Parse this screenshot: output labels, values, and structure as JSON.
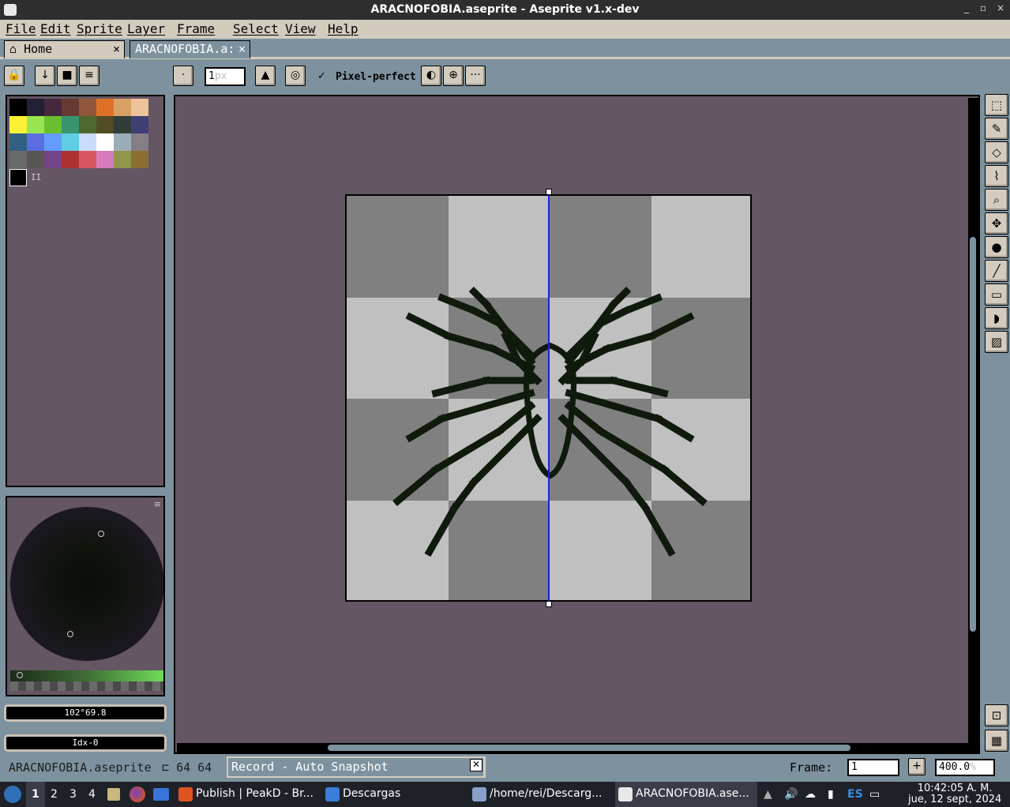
{
  "window": {
    "title": "ARACNOFOBIA.aseprite - Aseprite v1.x-dev",
    "controls": [
      "_",
      "▫",
      "×"
    ]
  },
  "menu": [
    "File",
    "Edit",
    "Sprite",
    "Layer",
    "Frame",
    "Select",
    "View",
    "Help"
  ],
  "tabs": [
    {
      "label": "Home",
      "close": "×",
      "active": false
    },
    {
      "label": "ARACNOFOBIA.a:",
      "close": "×",
      "active": true
    }
  ],
  "toolbar": {
    "brush_size_value": "1",
    "brush_size_unit": "px",
    "pixel_perfect_checked": true,
    "pixel_perfect_check": "✓",
    "pixel_perfect_label": "Pixel-perfect",
    "more_label": "···"
  },
  "palette": {
    "colors": [
      "#000000",
      "#222034",
      "#45283c",
      "#663931",
      "#8f563b",
      "#df7126",
      "#d9a066",
      "#eec39a",
      "#fbf236",
      "#99e550",
      "#6abe30",
      "#37946e",
      "#4b692f",
      "#524b24",
      "#323c39",
      "#3f3f74",
      "#306082",
      "#5b6ee1",
      "#639bff",
      "#5fcde4",
      "#cbdbfc",
      "#ffffff",
      "#9badb7",
      "#847e87",
      "#696a6a",
      "#595652",
      "#76428a",
      "#ac3232",
      "#d95763",
      "#d77bba",
      "#8f974a",
      "#8a6f30"
    ],
    "extra_label": "II"
  },
  "color_selector": {
    "hsv_readout": "102°69.8",
    "index_readout": "Idx-0"
  },
  "sprite": {
    "width": 64,
    "height": 64,
    "checker": [
      "dark",
      "light",
      "dark",
      "light",
      "light",
      "dark",
      "light",
      "dark",
      "dark",
      "light",
      "dark",
      "light",
      "light",
      "dark",
      "light",
      "dark"
    ],
    "primary_color": "#0f1a0c"
  },
  "tools": [
    {
      "name": "rectangular-marquee-icon",
      "glyph": "⬚"
    },
    {
      "name": "pencil-icon",
      "glyph": "✎"
    },
    {
      "name": "eraser-icon",
      "glyph": "◇"
    },
    {
      "name": "eyedropper-icon",
      "glyph": "⌇"
    },
    {
      "name": "zoom-icon",
      "glyph": "⌕"
    },
    {
      "name": "move-icon",
      "glyph": "✥"
    },
    {
      "name": "paint-bucket-icon",
      "glyph": "●"
    },
    {
      "name": "line-icon",
      "glyph": "╱"
    },
    {
      "name": "rectangle-icon",
      "glyph": "▭"
    },
    {
      "name": "contour-icon",
      "glyph": "◗"
    },
    {
      "name": "blur-icon",
      "glyph": "▨"
    }
  ],
  "status": {
    "filename": "ARACNOFOBIA.aseprite",
    "size_text": "64 64",
    "record_label": "Record - Auto Snapshot",
    "frame_label": "Frame:",
    "frame_value": "1",
    "zoom_value": "400.0",
    "zoom_unit": "%"
  },
  "taskbar": {
    "workspaces": [
      "1",
      "2",
      "3",
      "4"
    ],
    "tasks": [
      {
        "label": "Publish | PeakD - Br...",
        "color": "#e0531f"
      },
      {
        "label": "Descargas",
        "color": "#3b7dd8"
      },
      {
        "label": "/home/rei/Descarg...",
        "color": "#8aa0c8"
      },
      {
        "label": "ARACNOFOBIA.ase...",
        "color": "#e8e8e8"
      }
    ],
    "lang": "ES",
    "clock_time": "10:42:05 A. M.",
    "clock_date": "jue, 12 sept, 2024"
  }
}
